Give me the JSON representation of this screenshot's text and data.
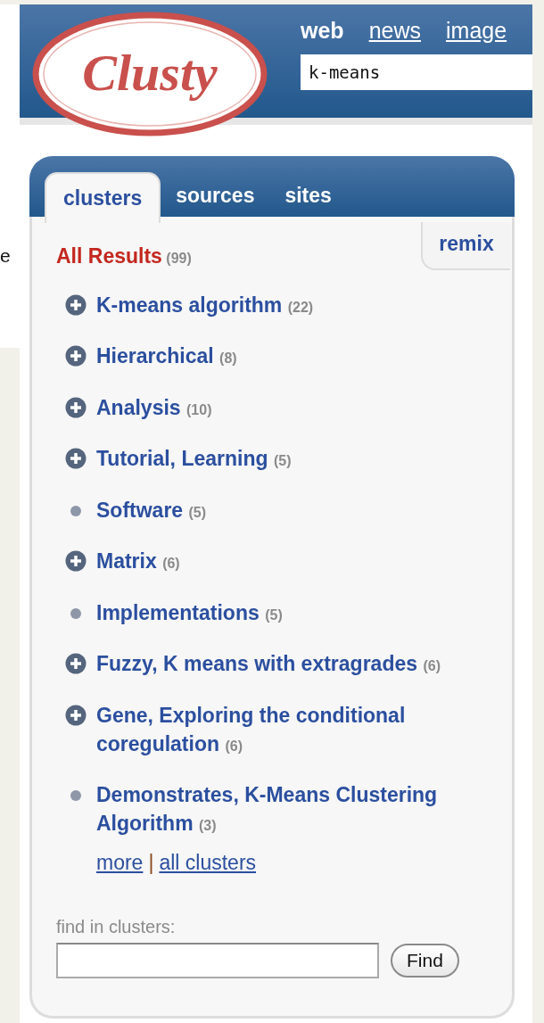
{
  "left_fragment": "e",
  "header": {
    "logo": "Clusty",
    "tabs": [
      {
        "label": "web",
        "selected": true
      },
      {
        "label": "news",
        "selected": false
      },
      {
        "label": "image",
        "selected": false
      }
    ],
    "search": {
      "value": "k-means"
    }
  },
  "panel": {
    "tabs": [
      {
        "label": "clusters",
        "selected": true
      },
      {
        "label": "sources",
        "selected": false
      },
      {
        "label": "sites",
        "selected": false
      }
    ],
    "remix": "remix",
    "all_results": {
      "label": "All Results",
      "count": "(99)"
    },
    "clusters": [
      {
        "kind": "expandable",
        "label": "K-means algorithm",
        "count": "(22)"
      },
      {
        "kind": "expandable",
        "label": "Hierarchical",
        "count": "(8)"
      },
      {
        "kind": "expandable",
        "label": "Analysis",
        "count": "(10)"
      },
      {
        "kind": "expandable",
        "label": "Tutorial, Learning",
        "count": "(5)"
      },
      {
        "kind": "leaf",
        "label": "Software",
        "count": "(5)"
      },
      {
        "kind": "expandable",
        "label": "Matrix",
        "count": "(6)"
      },
      {
        "kind": "leaf",
        "label": "Implementations",
        "count": "(5)"
      },
      {
        "kind": "expandable",
        "label": "Fuzzy, K means with extragrades",
        "count": "(6)"
      },
      {
        "kind": "expandable",
        "label": "Gene, Exploring the conditional coregulation",
        "count": "(6)"
      },
      {
        "kind": "leaf",
        "label": "Demonstrates, K-Means Clustering Algorithm",
        "count": "(3)"
      }
    ],
    "links": [
      "more",
      "all clusters"
    ],
    "separator": "|",
    "find": {
      "label": "find in clusters:",
      "button": "Find"
    }
  }
}
